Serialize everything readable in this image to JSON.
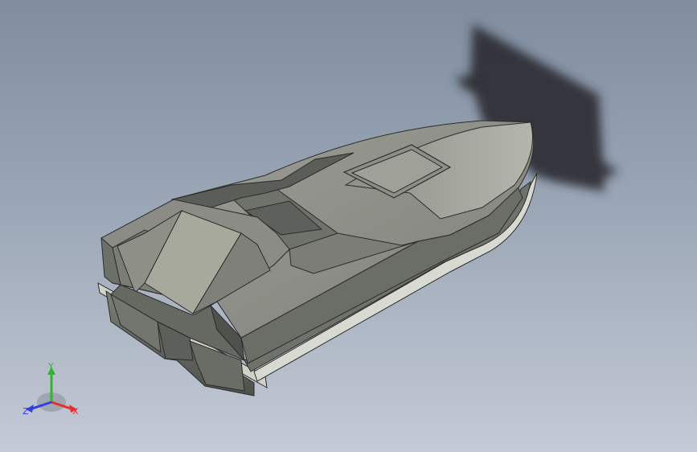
{
  "viewport": {
    "background_top": "#7f8d9f",
    "background_bottom": "#c4cad6"
  },
  "model": {
    "name_icon": "boat-hull-3d-model",
    "colors": {
      "hull_light": "#b7b8ae",
      "hull_mid": "#8f918a",
      "hull_dark": "#5f615c",
      "edge": "#2b2c2a",
      "shadow": "#2a2d33"
    }
  },
  "triad": {
    "x_label": "X",
    "y_label": "Y",
    "z_label": "Z",
    "x_color": "#e03030",
    "y_color": "#2fb52f",
    "z_color": "#2f3fe0"
  }
}
